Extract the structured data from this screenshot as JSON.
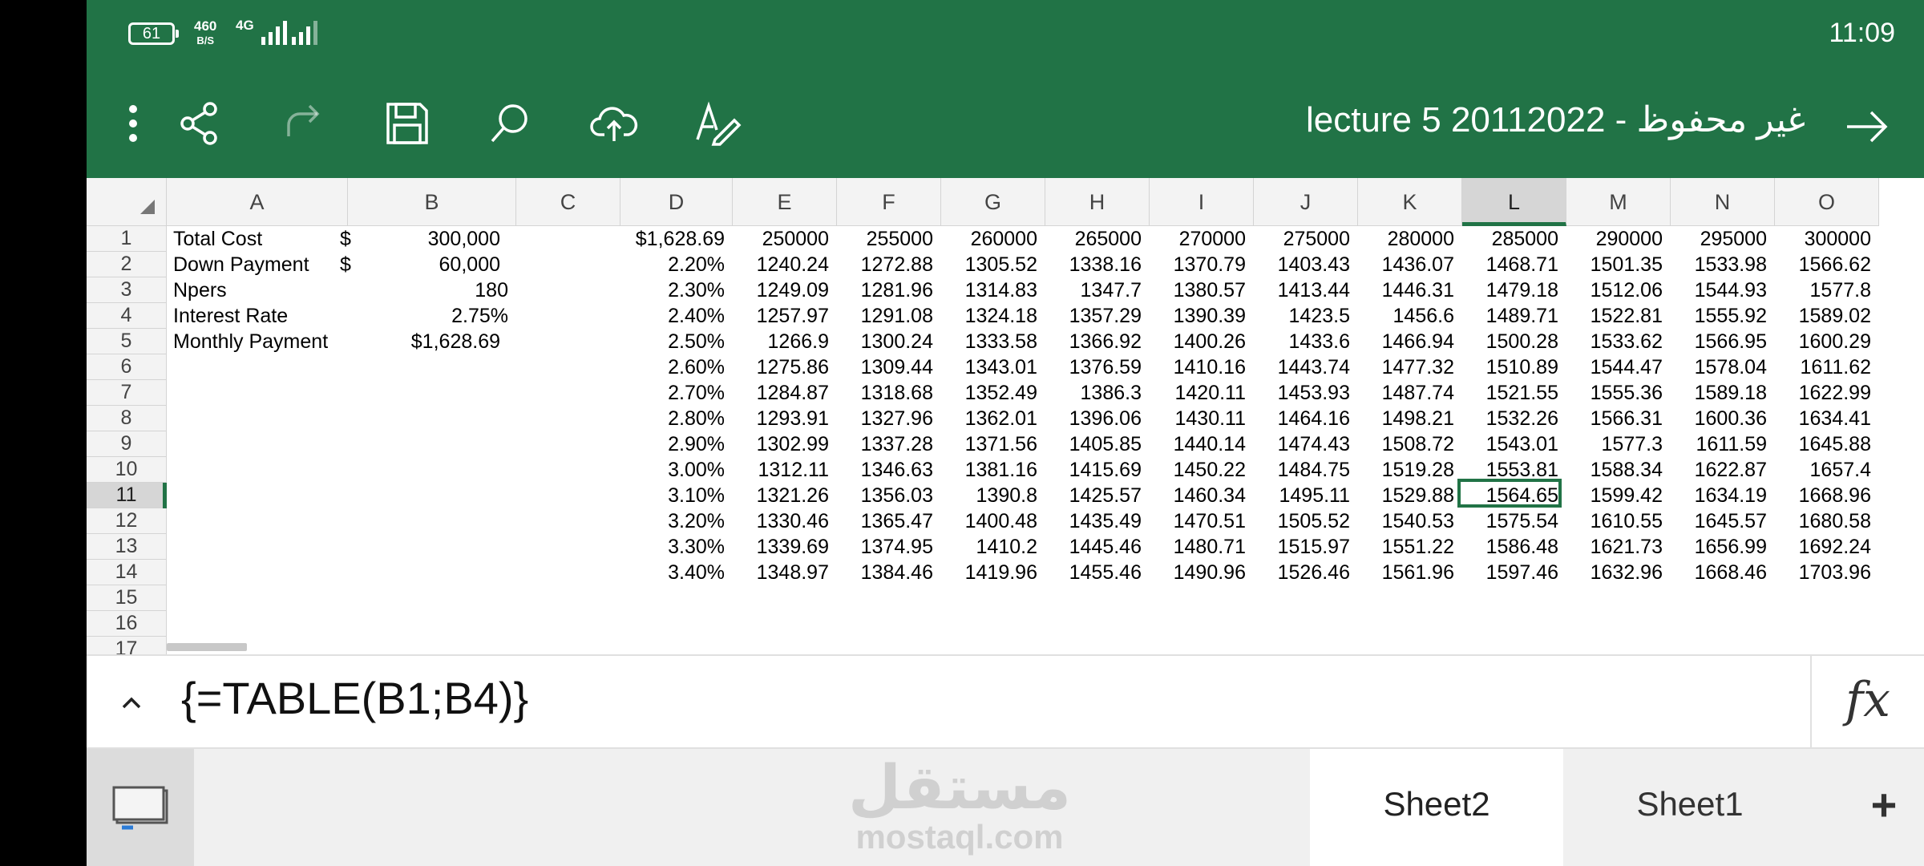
{
  "status_bar": {
    "battery": "61",
    "net_speed_value": "460",
    "net_speed_unit": "B/S",
    "network": "4G",
    "time": "11:09"
  },
  "toolbar": {
    "icons": [
      "more-vert-icon",
      "share-icon",
      "redo-icon",
      "save-icon",
      "search-icon",
      "cloud-upload-icon",
      "draw-icon"
    ],
    "title": "lecture 5  20112022 - غير محفوظ",
    "back_icon": "arrow-right-icon"
  },
  "sheet": {
    "columns": [
      "A",
      "B",
      "C",
      "D",
      "E",
      "F",
      "G",
      "H",
      "I",
      "J",
      "K",
      "L",
      "M",
      "N",
      "O"
    ],
    "selected_column": "L",
    "row_numbers": [
      "1",
      "2",
      "3",
      "4",
      "5",
      "6",
      "7",
      "8",
      "9",
      "10",
      "11",
      "12",
      "13",
      "14",
      "15",
      "16",
      "17"
    ],
    "selected_row": "11",
    "labels": {
      "a1": "Total Cost",
      "a2": "Down Payment",
      "a3": "Npers",
      "a4": "Interest Rate",
      "a5": "Monthly Payment",
      "b1_currency": "$",
      "b1": "300,000",
      "b2_currency": "$",
      "b2": "60,000",
      "b3": "180",
      "b4": "2.75%",
      "b5": "$1,628.69"
    },
    "table": {
      "corner": "$1,628.69",
      "cost_headers": [
        "250000",
        "255000",
        "260000",
        "265000",
        "270000",
        "275000",
        "280000",
        "285000",
        "290000",
        "295000",
        "300000"
      ],
      "rates": [
        "2.20%",
        "2.30%",
        "2.40%",
        "2.50%",
        "2.60%",
        "2.70%",
        "2.80%",
        "2.90%",
        "3.00%",
        "3.10%",
        "3.20%",
        "3.30%",
        "3.40%"
      ],
      "values": [
        [
          "1240.24",
          "1272.88",
          "1305.52",
          "1338.16",
          "1370.79",
          "1403.43",
          "1436.07",
          "1468.71",
          "1501.35",
          "1533.98",
          "1566.62"
        ],
        [
          "1249.09",
          "1281.96",
          "1314.83",
          "1347.7",
          "1380.57",
          "1413.44",
          "1446.31",
          "1479.18",
          "1512.06",
          "1544.93",
          "1577.8"
        ],
        [
          "1257.97",
          "1291.08",
          "1324.18",
          "1357.29",
          "1390.39",
          "1423.5",
          "1456.6",
          "1489.71",
          "1522.81",
          "1555.92",
          "1589.02"
        ],
        [
          "1266.9",
          "1300.24",
          "1333.58",
          "1366.92",
          "1400.26",
          "1433.6",
          "1466.94",
          "1500.28",
          "1533.62",
          "1566.95",
          "1600.29"
        ],
        [
          "1275.86",
          "1309.44",
          "1343.01",
          "1376.59",
          "1410.16",
          "1443.74",
          "1477.32",
          "1510.89",
          "1544.47",
          "1578.04",
          "1611.62"
        ],
        [
          "1284.87",
          "1318.68",
          "1352.49",
          "1386.3",
          "1420.11",
          "1453.93",
          "1487.74",
          "1521.55",
          "1555.36",
          "1589.18",
          "1622.99"
        ],
        [
          "1293.91",
          "1327.96",
          "1362.01",
          "1396.06",
          "1430.11",
          "1464.16",
          "1498.21",
          "1532.26",
          "1566.31",
          "1600.36",
          "1634.41"
        ],
        [
          "1302.99",
          "1337.28",
          "1371.56",
          "1405.85",
          "1440.14",
          "1474.43",
          "1508.72",
          "1543.01",
          "1577.3",
          "1611.59",
          "1645.88"
        ],
        [
          "1312.11",
          "1346.63",
          "1381.16",
          "1415.69",
          "1450.22",
          "1484.75",
          "1519.28",
          "1553.81",
          "1588.34",
          "1622.87",
          "1657.4"
        ],
        [
          "1321.26",
          "1356.03",
          "1390.8",
          "1425.57",
          "1460.34",
          "1495.11",
          "1529.88",
          "1564.65",
          "1599.42",
          "1634.19",
          "1668.96"
        ],
        [
          "1330.46",
          "1365.47",
          "1400.48",
          "1435.49",
          "1470.51",
          "1505.52",
          "1540.53",
          "1575.54",
          "1610.55",
          "1645.57",
          "1680.58"
        ],
        [
          "1339.69",
          "1374.95",
          "1410.2",
          "1445.46",
          "1480.71",
          "1515.97",
          "1551.22",
          "1586.48",
          "1621.73",
          "1656.99",
          "1692.24"
        ],
        [
          "1348.97",
          "1384.46",
          "1419.96",
          "1455.46",
          "1490.96",
          "1526.46",
          "1561.96",
          "1597.46",
          "1632.96",
          "1668.46",
          "1703.96"
        ]
      ]
    }
  },
  "formula_bar": {
    "formula": "{=TABLE(B1;B4)}",
    "fx_label": "fx"
  },
  "sheet_tabs": {
    "watermark_ar": "مستقل",
    "watermark_en": "mostaql.com",
    "tabs": [
      "Sheet2",
      "Sheet1"
    ],
    "active": "Sheet2",
    "add_label": "+"
  },
  "colors": {
    "excel_green": "#217346",
    "header_gray": "#f3f3f3",
    "selected_header": "#d6d6d6"
  }
}
